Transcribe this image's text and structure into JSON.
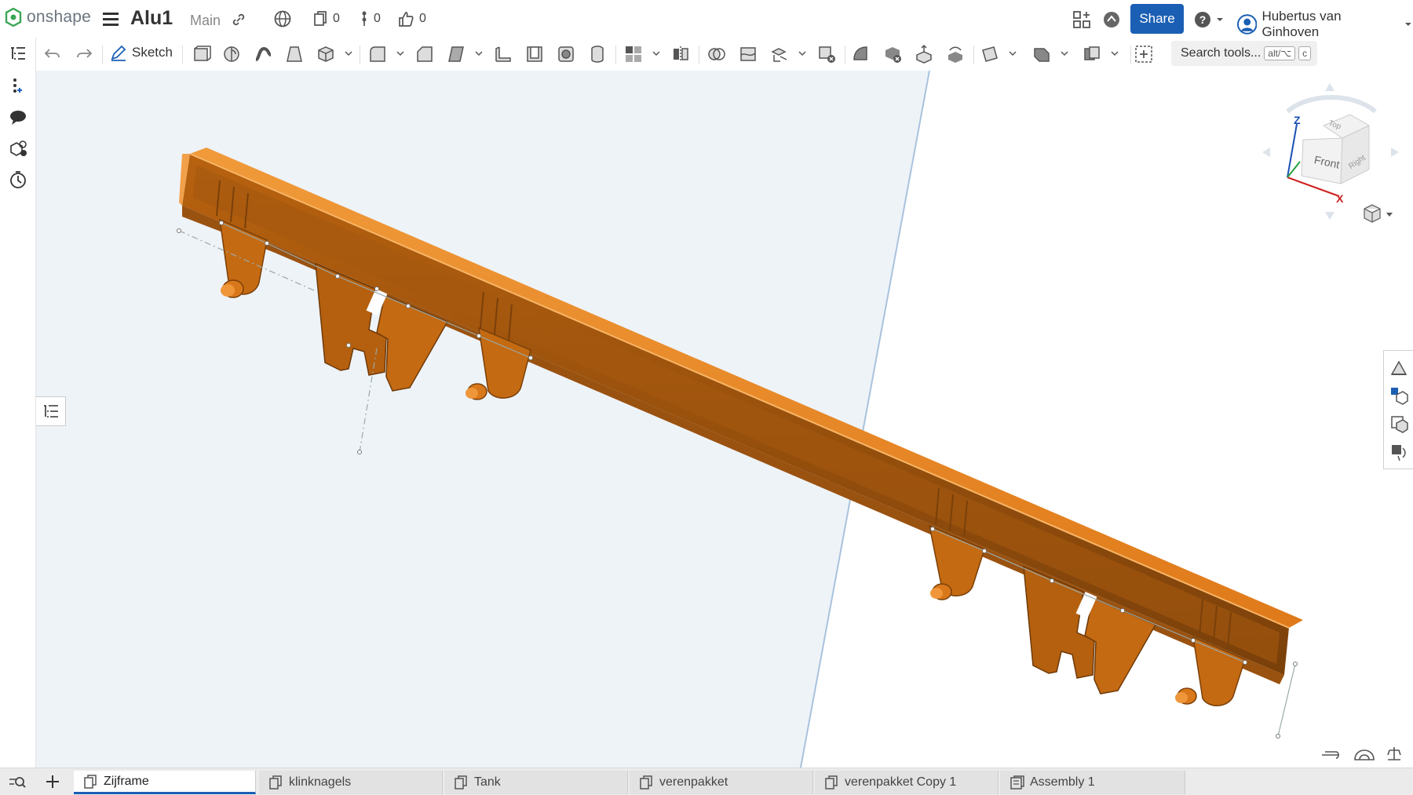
{
  "app": {
    "brand": "onshape"
  },
  "document": {
    "title": "Alu1",
    "branch": "Main"
  },
  "counters": {
    "versions": "0",
    "branches": "0",
    "likes": "0"
  },
  "header": {
    "share_label": "Share",
    "user_name": "Hubertus van Ginhoven"
  },
  "toolbar": {
    "sketch_label": "Sketch",
    "search": {
      "label": "Search tools...",
      "shortcut_alt": "alt/⌥",
      "shortcut_key": "c"
    }
  },
  "view_cube": {
    "faces": [
      "Front",
      "Top",
      "Right"
    ],
    "axes": [
      "Z",
      "X"
    ]
  },
  "tabs": [
    {
      "label": "Zijframe",
      "type": "part-studio",
      "active": true
    },
    {
      "label": "klinknagels",
      "type": "part-studio",
      "active": false
    },
    {
      "label": "Tank",
      "type": "part-studio",
      "active": false
    },
    {
      "label": "verenpakket",
      "type": "part-studio",
      "active": false
    },
    {
      "label": "verenpakket Copy 1",
      "type": "part-studio",
      "active": false
    },
    {
      "label": "Assembly 1",
      "type": "assembly",
      "active": false
    }
  ],
  "colors": {
    "accent": "#1a5fb4",
    "part": "#e07a1a",
    "part_dark": "#8a4a10",
    "viewport_plane": "#eef3f8"
  }
}
